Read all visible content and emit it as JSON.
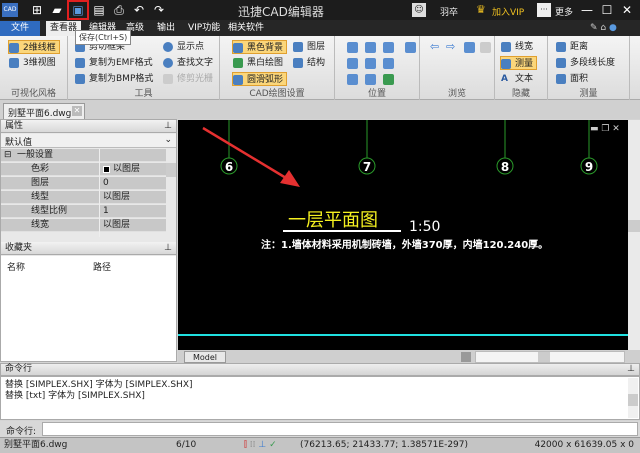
{
  "app": {
    "title": "迅捷CAD编辑器",
    "logo": "CAD",
    "user": "羽卒",
    "vip": "加入VIP",
    "more": "更多"
  },
  "tabs": [
    "文件",
    "查看器",
    "编辑器",
    "高级",
    "输出",
    "VIP功能",
    "相关软件"
  ],
  "tooltip": "保存(Ctrl+S)",
  "ribbon": {
    "visual": {
      "label": "可视化风格",
      "items": [
        "2维线框",
        "3维视图"
      ]
    },
    "tools": {
      "label": "工具",
      "items": [
        "剪切框架",
        "复制为EMF格式",
        "复制为BMP格式",
        "显示点",
        "查找文字",
        "修剪光栅"
      ]
    },
    "cad": {
      "label": "CAD绘图设置",
      "items": [
        "黑色背景",
        "黑白绘图",
        "圆滑弧形",
        "图层",
        "结构"
      ]
    },
    "position": {
      "label": "位置"
    },
    "browse": {
      "label": "浏览"
    },
    "hide": {
      "label": "隐藏",
      "items": [
        "线宽",
        "测量",
        "文本"
      ]
    },
    "measure": {
      "label": "测量",
      "items": [
        "距离",
        "多段线长度",
        "面积"
      ]
    }
  },
  "doc_tab": "别墅平面6.dwg",
  "properties": {
    "title": "属性",
    "dropdown": "默认值",
    "section": "一般设置",
    "rows": [
      {
        "k": "色彩",
        "v": "以图层"
      },
      {
        "k": "图层",
        "v": "0"
      },
      {
        "k": "线型",
        "v": "以图层"
      },
      {
        "k": "线型比例",
        "v": "1"
      },
      {
        "k": "线宽",
        "v": "以图层"
      }
    ]
  },
  "favorites": {
    "title": "收藏夹",
    "col1": "名称",
    "col2": "路径"
  },
  "drawing": {
    "axes": [
      "6",
      "7",
      "8",
      "9"
    ],
    "title": "一层平面图",
    "scale": "1:50",
    "note": "注：1.墙体材料采用机制砖墙，外墙370厚，内墙120.240厚。",
    "model_tab": "Model"
  },
  "command": {
    "title": "命令行",
    "lines": [
      "替换 [SIMPLEX.SHX] 字体为 [SIMPLEX.SHX]",
      "替换 [txt] 字体为 [SIMPLEX.SHX]"
    ],
    "prompt": "命令行:"
  },
  "status": {
    "file": "别墅平面6.dwg",
    "page": "6/10",
    "coords": "(76213.65; 21433.77; 1.38571E-297)",
    "size": "42000 x 61639.05 x 0"
  }
}
